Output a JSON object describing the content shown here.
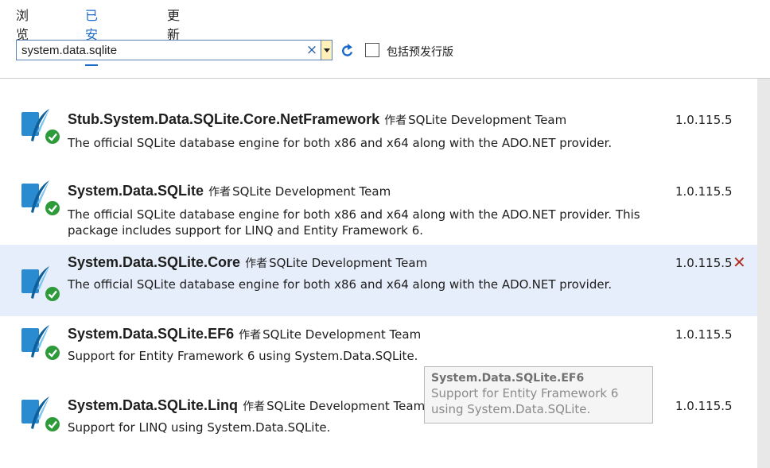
{
  "tabs": [
    {
      "label": "浏览"
    },
    {
      "label": "已安装"
    },
    {
      "label": "更新"
    }
  ],
  "search": {
    "value": "system.data.sqlite",
    "clear_glyph": "×"
  },
  "prerelease": {
    "label": "包括预发行版",
    "checked": false
  },
  "by_label": "作者",
  "colors": {
    "accent": "#1b6ac9",
    "selected_row": "#e6eefb",
    "installed_badge": "#2e9b3a",
    "icon_blue": "#2a8bd0",
    "uninstall": "#b03020"
  },
  "packages": [
    {
      "name": "Stub.System.Data.SQLite.Core.NetFramework",
      "author": "SQLite Development Team",
      "description": "The official SQLite database engine for both x86 and x64 along with the ADO.NET provider.",
      "version": "1.0.115.5",
      "icon": "sqlite-feather-icon",
      "installed": true,
      "selected": false
    },
    {
      "name": "System.Data.SQLite",
      "author": "SQLite Development Team",
      "description": "The official SQLite database engine for both x86 and x64 along with the ADO.NET provider.  This package includes support for LINQ and Entity Framework 6.",
      "version": "1.0.115.5",
      "icon": "sqlite-feather-icon",
      "installed": true,
      "selected": false
    },
    {
      "name": "System.Data.SQLite.Core",
      "author": "SQLite Development Team",
      "description": "The official SQLite database engine for both x86 and x64 along with the ADO.NET provider.",
      "version": "1.0.115.5",
      "icon": "sqlite-feather-icon",
      "installed": true,
      "selected": true,
      "uninstall_glyph": "✕"
    },
    {
      "name": "System.Data.SQLite.EF6",
      "author": "SQLite Development Team",
      "description": "Support for Entity Framework 6 using System.Data.SQLite.",
      "version": "1.0.115.5",
      "icon": "sqlite-feather-icon",
      "installed": true,
      "selected": false
    },
    {
      "name": "System.Data.SQLite.Linq",
      "author": "SQLite Development Team",
      "description": "Support for LINQ using System.Data.SQLite.",
      "version": "1.0.115.5",
      "icon": "sqlite-feather-icon",
      "installed": true,
      "selected": false
    }
  ],
  "tooltip": {
    "title": "System.Data.SQLite.EF6",
    "body": "Support for Entity Framework 6 using System.Data.SQLite."
  }
}
